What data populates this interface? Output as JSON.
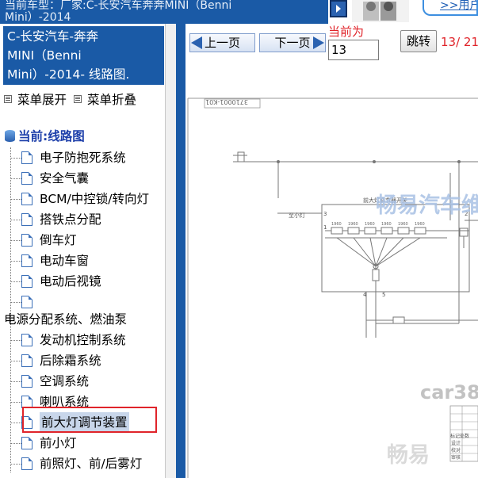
{
  "top": {
    "title_line1": "当前车型：厂家:C-长安汽车奔奔MINI（Benni",
    "title_line2": "Mini）-2014",
    "link_text": ">>用户"
  },
  "sidebar": {
    "car_title_lines": [
      "C-长安汽车-奔奔",
      "MINI（Benni",
      "Mini）-2014- 线路图."
    ],
    "expand_label": "菜单展开",
    "collapse_label": "菜单折叠",
    "current_label": "当前:线路图",
    "items_a": [
      "电子防抱死系统",
      "安全气囊",
      "BCM/中控锁/转向灯",
      "搭铁点分配",
      "倒车灯",
      "电动车窗",
      "电动后视镜",
      ""
    ],
    "section_label": "电源分配系统、燃油泵",
    "items_b": [
      "发动机控制系统",
      "后除霜系统",
      "空调系统",
      "喇叭系统",
      "前大灯调节装置",
      "前小灯",
      "前照灯、前/后雾灯"
    ]
  },
  "nav": {
    "prev_label": "上一页",
    "next_label": "下一页",
    "current_label": "当前为",
    "page_value": "13",
    "jump_label": "跳转",
    "page_count": "13/ 21"
  },
  "diagram": {
    "code_label": "3710001-K01",
    "watermark_1": "畅易汽车维",
    "watermark_2": "car38",
    "watermark_3": "畅易",
    "switch_title": "前大灯调节器开关",
    "left_label": "至小灯",
    "resistor_labels": [
      "1960",
      "1960",
      "1960",
      "1960",
      "1960",
      "1960"
    ],
    "title_block": [
      "标记处数",
      "设计",
      "校对",
      "审核"
    ],
    "pins": [
      "3",
      "2",
      "1",
      "4",
      "5"
    ]
  },
  "colors": {
    "accent_blue": "#1a5aa6",
    "red_text": "#e0242a",
    "highlight_red": "#e0242a"
  }
}
